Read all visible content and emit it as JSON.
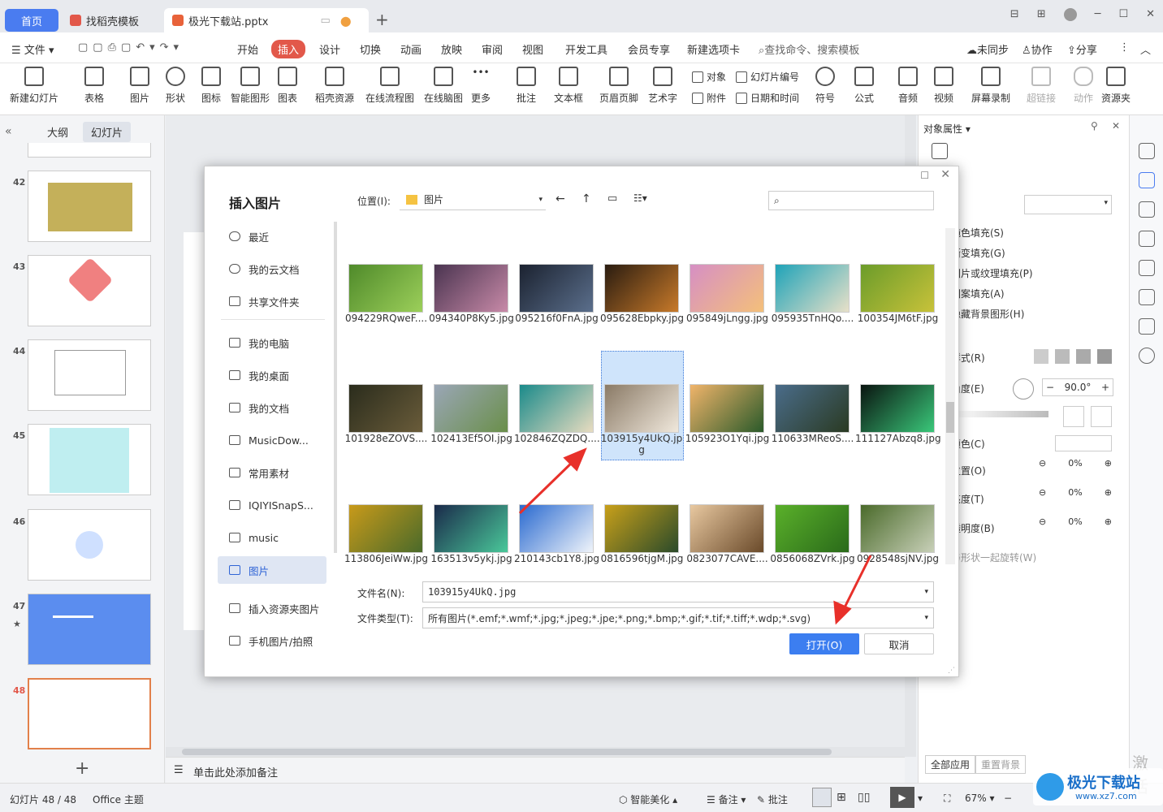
{
  "tabs": {
    "home": "首页",
    "template": "找稻壳模板",
    "doc": "极光下载站.pptx"
  },
  "menu": {
    "file": "文件",
    "start": "开始",
    "insert": "插入",
    "design": "设计",
    "switch": "切换",
    "animation": "动画",
    "slideshow": "放映",
    "review": "审阅",
    "view": "视图",
    "dev": "开发工具",
    "member": "会员专享",
    "newtab": "新建选项卡",
    "search": "查找命令、搜索模板",
    "sync": "未同步",
    "collab": "协作",
    "share": "分享"
  },
  "ribbon": {
    "new_slide": "新建幻灯片",
    "table": "表格",
    "picture": "图片",
    "shape": "形状",
    "icon": "图标",
    "smart": "智能图形",
    "chart": "图表",
    "resource": "稻壳资源",
    "flow": "在线流程图",
    "mind": "在线脑图",
    "more": "更多",
    "comment": "批注",
    "textbox": "文本框",
    "header": "页眉页脚",
    "art": "艺术字",
    "object": "对象",
    "slide_no": "幻灯片编号",
    "attach": "附件",
    "datetime": "日期和时间",
    "symbol": "符号",
    "formula": "公式",
    "audio": "音频",
    "video": "视频",
    "screen": "屏幕录制",
    "link": "超链接",
    "action": "动作",
    "resfolder": "资源夹"
  },
  "left_pane": {
    "outline": "大纲",
    "slides": "幻灯片",
    "nums": [
      "42",
      "43",
      "44",
      "45",
      "46",
      "47",
      "48"
    ]
  },
  "notes": "单击此处添加备注",
  "right_panel": {
    "title": "对象属性",
    "items": [
      "纯色填充(S)",
      "渐变填充(G)",
      "图片或纹理填充(P)",
      "图案填充(A)",
      "隐藏背景图形(H)",
      "样式(R)",
      "角度(E)",
      "颜色(C)",
      "位置(O)",
      "亮度(T)",
      "透明度(B)",
      "与形状一起旋转(W)"
    ],
    "angle": "90.0°",
    "pct": "0%",
    "apply_all": "全部应用",
    "reset_bg": "重置背景"
  },
  "dialog": {
    "title": "插入图片",
    "location_label": "位置(I):",
    "location": "图片",
    "nav": [
      "最近",
      "我的云文档",
      "共享文件夹",
      "我的电脑",
      "我的桌面",
      "我的文档",
      "MusicDow...",
      "常用素材",
      "IQIYISnapS...",
      "music",
      "图片",
      "插入资源夹图片",
      "手机图片/拍照"
    ],
    "files": [
      "094229RQweF....",
      "094340P8Ky5.jpg",
      "095216f0FnA.jpg",
      "095628Ebpky.jpg",
      "095849jLngg.jpg",
      "095935TnHQo....",
      "100354JM6tF.jpg",
      "101928eZOVS....",
      "102413Ef5OI.jpg",
      "102846ZQZDQ....",
      "103915y4UkQ.jpg",
      "105923O1Yqi.jpg",
      "110633MReoS....",
      "111127Abzq8.jpg",
      "113806JeiWw.jpg",
      "163513v5ykj.jpg",
      "210143cb1Y8.jpg",
      "0816596tjgM.jpg",
      "0823077CAVE....",
      "0856068ZVrk.jpg",
      "0928548sjNV.jpg"
    ],
    "filename_label": "文件名(N):",
    "filename": "103915y4UkQ.jpg",
    "filetype_label": "文件类型(T):",
    "filetype": "所有图片(*.emf;*.wmf;*.jpg;*.jpeg;*.jpe;*.png;*.bmp;*.gif;*.tif;*.tiff;*.wdp;*.svg)",
    "open": "打开(O)",
    "cancel": "取消"
  },
  "status": {
    "slide": "幻灯片 48 / 48",
    "theme": "Office 主题",
    "beautify": "智能美化",
    "notes": "备注",
    "comment": "批注",
    "zoom": "67%"
  },
  "watermark": {
    "site": "极光下载站",
    "url": "www.xz7.com",
    "activate": "激活"
  },
  "colors": {
    "accent": "#e2584a",
    "blue": "#4a7cf0",
    "open_btn": "#3c7ef0",
    "arrow": "#e8302a"
  }
}
